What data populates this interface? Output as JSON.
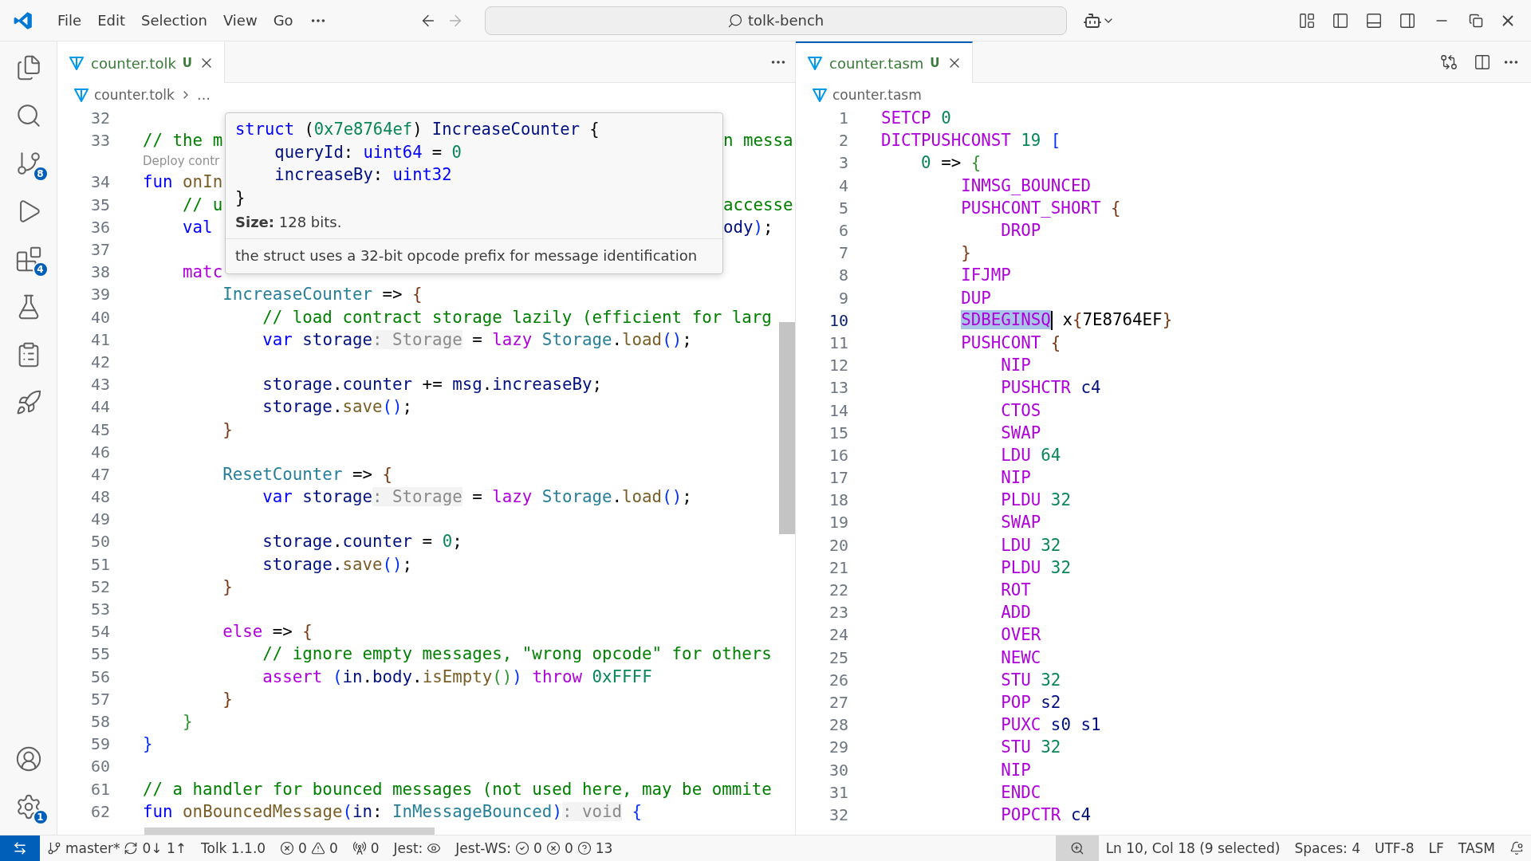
{
  "title_bar": {
    "menu": [
      "File",
      "Edit",
      "Selection",
      "View",
      "Go"
    ],
    "search": "tolk-bench"
  },
  "activity_bar": {
    "top": [
      {
        "kind": "explorer"
      },
      {
        "kind": "search"
      },
      {
        "kind": "source-control",
        "badge": "8"
      },
      {
        "kind": "run"
      },
      {
        "kind": "extensions",
        "badge": "4"
      },
      {
        "kind": "testing"
      },
      {
        "kind": "docs"
      },
      {
        "kind": "deploy"
      }
    ],
    "bottom": [
      {
        "kind": "account"
      },
      {
        "kind": "settings",
        "badge": "1"
      }
    ]
  },
  "left_editor": {
    "focused": false,
    "tabs": [
      {
        "title": "counter.tolk",
        "status": "U",
        "selected": true
      }
    ],
    "breadcrumb": [
      "counter.tolk",
      "…"
    ],
    "lines": [
      {
        "kind": "code",
        "number": "32"
      },
      {
        "kind": "code",
        "number": "33",
        "tokens": [
          {
            "kind": "comment",
            "text": "// the m"
          }
        ],
        "tail": [
          {
            "kind": "comment",
            "text": "n messa"
          }
        ]
      },
      {
        "kind": "codelens",
        "text": "Deploy contr"
      },
      {
        "kind": "code",
        "number": "34",
        "tokens": [
          {
            "kind": "keyword",
            "text": "fun "
          },
          {
            "kind": "func",
            "text": "onIn"
          }
        ]
      },
      {
        "kind": "code",
        "number": "35",
        "tokens": [
          {
            "kind": "comment",
            "text": "    // u"
          }
        ],
        "tail": [
          {
            "kind": "comment",
            "text": "accesse"
          }
        ]
      },
      {
        "kind": "code",
        "number": "36",
        "tokens": [
          {
            "kind": "keyword",
            "text": "    val"
          }
        ],
        "tail": [
          {
            "kind": "var",
            "text": "ody"
          },
          {
            "kind": "b1",
            "text": ")"
          },
          {
            "kind": "plain",
            "text": ";"
          }
        ]
      },
      {
        "kind": "code",
        "number": "37"
      },
      {
        "kind": "code",
        "number": "38",
        "tokens": [
          {
            "kind": "control",
            "text": "    matc"
          }
        ]
      },
      {
        "kind": "code",
        "number": "39",
        "tokens": [
          {
            "kind": "type",
            "text": "        IncreaseCounter"
          },
          {
            "kind": "plain",
            "text": " => "
          },
          {
            "kind": "b3",
            "text": "{"
          }
        ]
      },
      {
        "kind": "code",
        "number": "40",
        "tokens": [
          {
            "kind": "comment",
            "text": "            // load contract storage lazily (efficient for larg"
          }
        ]
      },
      {
        "kind": "code",
        "number": "41",
        "tokens": [
          {
            "kind": "keyword",
            "text": "            var "
          },
          {
            "kind": "var",
            "text": "storage"
          },
          {
            "kind": "hint",
            "text": ": Storage"
          },
          {
            "kind": "plain",
            "text": " = "
          },
          {
            "kind": "control",
            "text": "lazy "
          },
          {
            "kind": "type",
            "text": "Storage"
          },
          {
            "kind": "plain",
            "text": "."
          },
          {
            "kind": "func",
            "text": "load"
          },
          {
            "kind": "b1",
            "text": "()"
          },
          {
            "kind": "plain",
            "text": ";"
          }
        ]
      },
      {
        "kind": "code",
        "number": "42"
      },
      {
        "kind": "code",
        "number": "43",
        "tokens": [
          {
            "kind": "var",
            "text": "            storage"
          },
          {
            "kind": "plain",
            "text": "."
          },
          {
            "kind": "var",
            "text": "counter"
          },
          {
            "kind": "plain",
            "text": " += "
          },
          {
            "kind": "var",
            "text": "msg"
          },
          {
            "kind": "plain",
            "text": "."
          },
          {
            "kind": "var",
            "text": "increaseBy"
          },
          {
            "kind": "plain",
            "text": ";"
          }
        ]
      },
      {
        "kind": "code",
        "number": "44",
        "tokens": [
          {
            "kind": "var",
            "text": "            storage"
          },
          {
            "kind": "plain",
            "text": "."
          },
          {
            "kind": "func",
            "text": "save"
          },
          {
            "kind": "b1",
            "text": "()"
          },
          {
            "kind": "plain",
            "text": ";"
          }
        ]
      },
      {
        "kind": "code",
        "number": "45",
        "tokens": [
          {
            "kind": "b3",
            "text": "        }"
          }
        ]
      },
      {
        "kind": "code",
        "number": "46"
      },
      {
        "kind": "code",
        "number": "47",
        "tokens": [
          {
            "kind": "type",
            "text": "        ResetCounter"
          },
          {
            "kind": "plain",
            "text": " => "
          },
          {
            "kind": "b3",
            "text": "{"
          }
        ]
      },
      {
        "kind": "code",
        "number": "48",
        "tokens": [
          {
            "kind": "keyword",
            "text": "            var "
          },
          {
            "kind": "var",
            "text": "storage"
          },
          {
            "kind": "hint",
            "text": ": Storage"
          },
          {
            "kind": "plain",
            "text": " = "
          },
          {
            "kind": "control",
            "text": "lazy "
          },
          {
            "kind": "type",
            "text": "Storage"
          },
          {
            "kind": "plain",
            "text": "."
          },
          {
            "kind": "func",
            "text": "load"
          },
          {
            "kind": "b1",
            "text": "()"
          },
          {
            "kind": "plain",
            "text": ";"
          }
        ]
      },
      {
        "kind": "code",
        "number": "49"
      },
      {
        "kind": "code",
        "number": "50",
        "tokens": [
          {
            "kind": "var",
            "text": "            storage"
          },
          {
            "kind": "plain",
            "text": "."
          },
          {
            "kind": "var",
            "text": "counter"
          },
          {
            "kind": "plain",
            "text": " = "
          },
          {
            "kind": "number",
            "text": "0"
          },
          {
            "kind": "plain",
            "text": ";"
          }
        ]
      },
      {
        "kind": "code",
        "number": "51",
        "tokens": [
          {
            "kind": "var",
            "text": "            storage"
          },
          {
            "kind": "plain",
            "text": "."
          },
          {
            "kind": "func",
            "text": "save"
          },
          {
            "kind": "b1",
            "text": "()"
          },
          {
            "kind": "plain",
            "text": ";"
          }
        ]
      },
      {
        "kind": "code",
        "number": "52",
        "tokens": [
          {
            "kind": "b3",
            "text": "        }"
          }
        ]
      },
      {
        "kind": "code",
        "number": "53"
      },
      {
        "kind": "code",
        "number": "54",
        "tokens": [
          {
            "kind": "control",
            "text": "        else"
          },
          {
            "kind": "plain",
            "text": " => "
          },
          {
            "kind": "b3",
            "text": "{"
          }
        ]
      },
      {
        "kind": "code",
        "number": "55",
        "tokens": [
          {
            "kind": "comment",
            "text": "            // ignore empty messages, \"wrong opcode\" for others"
          }
        ]
      },
      {
        "kind": "code",
        "number": "56",
        "tokens": [
          {
            "kind": "control",
            "text": "            assert "
          },
          {
            "kind": "b1",
            "text": "("
          },
          {
            "kind": "var",
            "text": "in"
          },
          {
            "kind": "plain",
            "text": "."
          },
          {
            "kind": "var",
            "text": "body"
          },
          {
            "kind": "plain",
            "text": "."
          },
          {
            "kind": "func",
            "text": "isEmpty"
          },
          {
            "kind": "b2",
            "text": "()"
          },
          {
            "kind": "b1",
            "text": ")"
          },
          {
            "kind": "control",
            "text": " throw "
          },
          {
            "kind": "number",
            "text": "0xFFFF"
          }
        ]
      },
      {
        "kind": "code",
        "number": "57",
        "tokens": [
          {
            "kind": "b3",
            "text": "        }"
          }
        ]
      },
      {
        "kind": "code",
        "number": "58",
        "tokens": [
          {
            "kind": "b2",
            "text": "    }"
          }
        ]
      },
      {
        "kind": "code",
        "number": "59",
        "tokens": [
          {
            "kind": "b1",
            "text": "}"
          }
        ]
      },
      {
        "kind": "code",
        "number": "60"
      },
      {
        "kind": "code",
        "number": "61",
        "tokens": [
          {
            "kind": "comment",
            "text": "// a handler for bounced messages (not used here, may be ommite"
          }
        ]
      },
      {
        "kind": "code",
        "number": "62",
        "tokens": [
          {
            "kind": "keyword",
            "text": "fun "
          },
          {
            "kind": "func",
            "text": "onBouncedMessage"
          },
          {
            "kind": "b1",
            "text": "("
          },
          {
            "kind": "var",
            "text": "in"
          },
          {
            "kind": "plain",
            "text": ": "
          },
          {
            "kind": "type",
            "text": "InMessageBounced"
          },
          {
            "kind": "b1",
            "text": ")"
          },
          {
            "kind": "hint",
            "text": ": void"
          },
          {
            "kind": "b1",
            "text": " {"
          }
        ]
      }
    ],
    "hover": {
      "code": [
        [
          {
            "kind": "keyword",
            "text": "struct"
          },
          {
            "kind": "plain",
            "text": " ("
          },
          {
            "kind": "number",
            "text": "0x7e8764ef"
          },
          {
            "kind": "plain",
            "text": ") "
          },
          {
            "kind": "var",
            "text": "IncreaseCounter"
          },
          {
            "kind": "plain",
            "text": " {"
          }
        ],
        [
          {
            "kind": "var",
            "text": "    queryId"
          },
          {
            "kind": "plain",
            "text": ": "
          },
          {
            "kind": "keyword",
            "text": "uint64"
          },
          {
            "kind": "plain",
            "text": " = "
          },
          {
            "kind": "number",
            "text": "0"
          }
        ],
        [
          {
            "kind": "var",
            "text": "    increaseBy"
          },
          {
            "kind": "plain",
            "text": ": "
          },
          {
            "kind": "keyword",
            "text": "uint32"
          }
        ],
        [
          {
            "kind": "plain",
            "text": "}"
          }
        ]
      ],
      "size": "**Size:** 128 bits.",
      "description": "the struct uses a 32-bit opcode prefix for message identification"
    }
  },
  "right_editor": {
    "focused": true,
    "tabs": [
      {
        "title": "counter.tasm",
        "status": "U",
        "selected": true
      }
    ],
    "breadcrumb": [
      "counter.tasm"
    ],
    "lines": [
      {
        "number": "1",
        "current": false,
        "tokens": [
          {
            "kind": "control",
            "text": "SETCP "
          },
          {
            "kind": "number",
            "text": "0"
          }
        ]
      },
      {
        "number": "2",
        "current": false,
        "tokens": [
          {
            "kind": "control",
            "text": "DICTPUSHCONST "
          },
          {
            "kind": "number",
            "text": "19 "
          },
          {
            "kind": "b1",
            "text": "["
          }
        ]
      },
      {
        "number": "3",
        "current": false,
        "tokens": [
          {
            "kind": "number",
            "text": "    0"
          },
          {
            "kind": "plain",
            "text": " => "
          },
          {
            "kind": "b2",
            "text": "{"
          }
        ]
      },
      {
        "number": "4",
        "current": false,
        "tokens": [
          {
            "kind": "control",
            "text": "        INMSG_BOUNCED"
          }
        ]
      },
      {
        "number": "5",
        "current": false,
        "tokens": [
          {
            "kind": "control",
            "text": "        PUSHCONT_SHORT "
          },
          {
            "kind": "b3",
            "text": "{"
          }
        ]
      },
      {
        "number": "6",
        "current": false,
        "tokens": [
          {
            "kind": "control",
            "text": "            DROP"
          }
        ]
      },
      {
        "number": "7",
        "current": false,
        "tokens": [
          {
            "kind": "b3",
            "text": "        }"
          }
        ]
      },
      {
        "number": "8",
        "current": false,
        "tokens": [
          {
            "kind": "control",
            "text": "        IFJMP"
          }
        ]
      },
      {
        "number": "9",
        "current": false,
        "tokens": [
          {
            "kind": "control",
            "text": "        DUP"
          }
        ]
      },
      {
        "number": "10",
        "current": true,
        "tokens": [
          {
            "kind": "control",
            "text": "        SDBEGINSQ",
            "selected": true
          },
          {
            "kind": "plain",
            "text": " x",
            "selected": false
          },
          {
            "kind": "b3",
            "text": "{",
            "selected": false
          },
          {
            "kind": "plain",
            "text": "7E8764EF",
            "selected": false
          },
          {
            "kind": "b3",
            "text": "}",
            "selected": false
          }
        ]
      },
      {
        "number": "11",
        "current": false,
        "tokens": [
          {
            "kind": "control",
            "text": "        PUSHCONT "
          },
          {
            "kind": "b3",
            "text": "{"
          }
        ]
      },
      {
        "number": "12",
        "current": false,
        "tokens": [
          {
            "kind": "control",
            "text": "            NIP"
          }
        ]
      },
      {
        "number": "13",
        "current": false,
        "tokens": [
          {
            "kind": "control",
            "text": "            PUSHCTR "
          },
          {
            "kind": "var",
            "text": "c4"
          }
        ]
      },
      {
        "number": "14",
        "current": false,
        "tokens": [
          {
            "kind": "control",
            "text": "            CTOS"
          }
        ]
      },
      {
        "number": "15",
        "current": false,
        "tokens": [
          {
            "kind": "control",
            "text": "            SWAP"
          }
        ]
      },
      {
        "number": "16",
        "current": false,
        "tokens": [
          {
            "kind": "control",
            "text": "            LDU "
          },
          {
            "kind": "number",
            "text": "64"
          }
        ]
      },
      {
        "number": "17",
        "current": false,
        "tokens": [
          {
            "kind": "control",
            "text": "            NIP"
          }
        ]
      },
      {
        "number": "18",
        "current": false,
        "tokens": [
          {
            "kind": "control",
            "text": "            PLDU "
          },
          {
            "kind": "number",
            "text": "32"
          }
        ]
      },
      {
        "number": "19",
        "current": false,
        "tokens": [
          {
            "kind": "control",
            "text": "            SWAP"
          }
        ]
      },
      {
        "number": "20",
        "current": false,
        "tokens": [
          {
            "kind": "control",
            "text": "            LDU "
          },
          {
            "kind": "number",
            "text": "32"
          }
        ]
      },
      {
        "number": "21",
        "current": false,
        "tokens": [
          {
            "kind": "control",
            "text": "            PLDU "
          },
          {
            "kind": "number",
            "text": "32"
          }
        ]
      },
      {
        "number": "22",
        "current": false,
        "tokens": [
          {
            "kind": "control",
            "text": "            ROT"
          }
        ]
      },
      {
        "number": "23",
        "current": false,
        "tokens": [
          {
            "kind": "control",
            "text": "            ADD"
          }
        ]
      },
      {
        "number": "24",
        "current": false,
        "tokens": [
          {
            "kind": "control",
            "text": "            OVER"
          }
        ]
      },
      {
        "number": "25",
        "current": false,
        "tokens": [
          {
            "kind": "control",
            "text": "            NEWC"
          }
        ]
      },
      {
        "number": "26",
        "current": false,
        "tokens": [
          {
            "kind": "control",
            "text": "            STU "
          },
          {
            "kind": "number",
            "text": "32"
          }
        ]
      },
      {
        "number": "27",
        "current": false,
        "tokens": [
          {
            "kind": "control",
            "text": "            POP "
          },
          {
            "kind": "var",
            "text": "s2"
          }
        ]
      },
      {
        "number": "28",
        "current": false,
        "tokens": [
          {
            "kind": "control",
            "text": "            PUXC "
          },
          {
            "kind": "var",
            "text": "s0 s1"
          }
        ]
      },
      {
        "number": "29",
        "current": false,
        "tokens": [
          {
            "kind": "control",
            "text": "            STU "
          },
          {
            "kind": "number",
            "text": "32"
          }
        ]
      },
      {
        "number": "30",
        "current": false,
        "tokens": [
          {
            "kind": "control",
            "text": "            NIP"
          }
        ]
      },
      {
        "number": "31",
        "current": false,
        "tokens": [
          {
            "kind": "control",
            "text": "            ENDC"
          }
        ]
      },
      {
        "number": "32",
        "current": false,
        "tokens": [
          {
            "kind": "control",
            "text": "            POPCTR "
          },
          {
            "kind": "var",
            "text": "c4"
          }
        ]
      }
    ]
  },
  "status_bar": {
    "left": [
      {
        "parts": [
          {
            "kind": "branch",
            "text": "master*"
          },
          {
            "kind": "sync",
            "text": "0↓ 1↑"
          }
        ]
      },
      {
        "parts": [
          {
            "kind": "plain",
            "text": "Tolk 1.1.0"
          }
        ]
      },
      {
        "parts": [
          {
            "kind": "error",
            "text": "0"
          },
          {
            "kind": "warning",
            "text": "0"
          }
        ]
      },
      {
        "parts": [
          {
            "kind": "ports",
            "text": "0"
          }
        ]
      },
      {
        "parts": [
          {
            "kind": "plain",
            "text": "Jest:"
          },
          {
            "kind": "watch"
          }
        ]
      },
      {
        "parts": [
          {
            "kind": "plain",
            "text": "Jest-WS:"
          },
          {
            "kind": "passed",
            "text": "0"
          },
          {
            "kind": "error",
            "text": "0"
          },
          {
            "kind": "unknown",
            "text": "13"
          }
        ]
      }
    ],
    "right": [
      {
        "parts": [
          {
            "kind": "zoom"
          }
        ]
      },
      {
        "parts": [
          {
            "kind": "plain",
            "text": "Ln 10, Col 18 (9 selected)"
          }
        ]
      },
      {
        "parts": [
          {
            "kind": "plain",
            "text": "Spaces: 4"
          }
        ]
      },
      {
        "parts": [
          {
            "kind": "plain",
            "text": "UTF-8"
          }
        ]
      },
      {
        "parts": [
          {
            "kind": "plain",
            "text": "LF"
          }
        ]
      },
      {
        "parts": [
          {
            "kind": "plain",
            "text": "TASM"
          }
        ]
      },
      {
        "parts": [
          {
            "kind": "bell"
          }
        ]
      }
    ]
  }
}
